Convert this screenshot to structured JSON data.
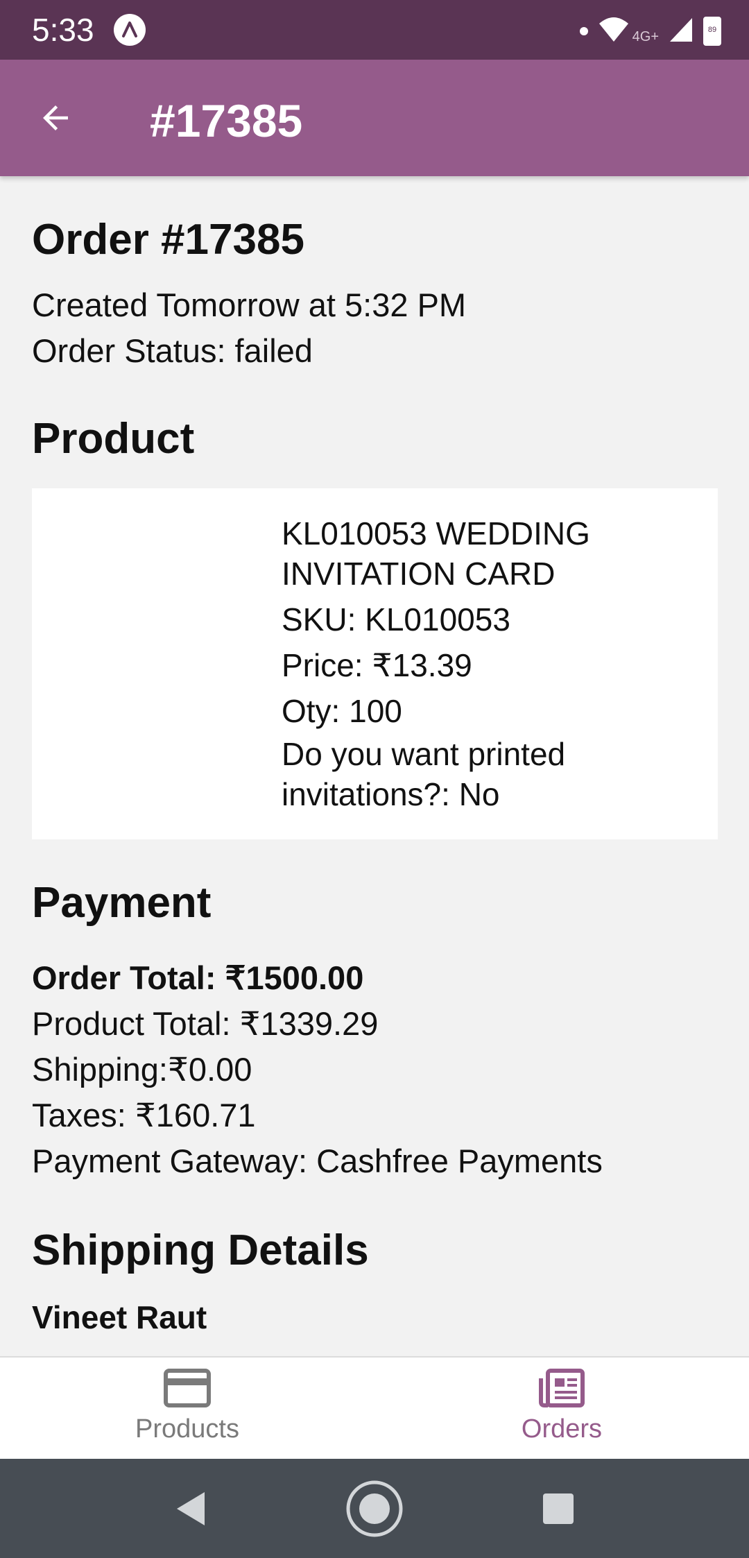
{
  "status_bar": {
    "time": "5:33",
    "network": "4G+",
    "battery": "89"
  },
  "app_bar": {
    "title": "#17385"
  },
  "order": {
    "heading": "Order #17385",
    "created": "Created Tomorrow at 5:32 PM",
    "status": "Order Status: failed"
  },
  "product": {
    "heading": "Product",
    "name": "KL010053 WEDDING INVITATION CARD",
    "sku": "SKU: KL010053",
    "price": "Price: ₹13.39",
    "qty": "Oty: 100",
    "question": "Do you want printed invitations?: No"
  },
  "payment": {
    "heading": "Payment",
    "order_total": "Order Total: ₹1500.00",
    "product_total": "Product Total: ₹1339.29",
    "shipping": "Shipping:₹0.00",
    "taxes": "Taxes: ₹160.71",
    "gateway": "Payment Gateway: Cashfree Payments"
  },
  "shipping": {
    "heading": "Shipping Details",
    "name": "Vineet Raut"
  },
  "bottom_nav": {
    "items": [
      {
        "label": "Products",
        "icon": "card-icon",
        "active": false
      },
      {
        "label": "Orders",
        "icon": "receipt-icon",
        "active": true
      }
    ]
  },
  "colors": {
    "status_bar": "#5a3454",
    "app_bar": "#955b8b",
    "accent": "#955b8b",
    "background": "#f2f2f2",
    "system_nav": "#474d54"
  }
}
